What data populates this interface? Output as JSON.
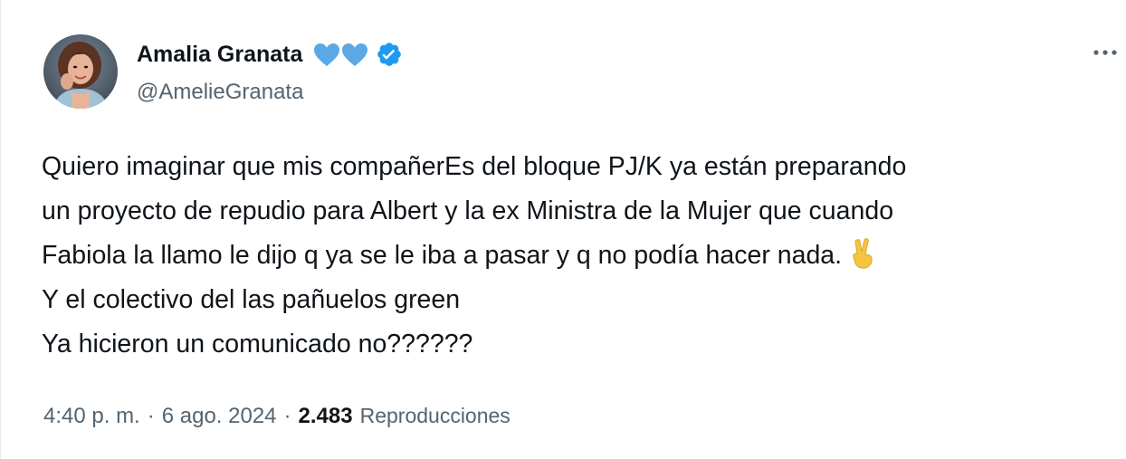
{
  "tweet": {
    "author": {
      "display_name": "Amalia Granata",
      "handle": "@AmelieGranata",
      "avatar": "profile-photo",
      "badges": [
        "light-blue-heart-icon",
        "light-blue-heart-icon",
        "verified-badge-icon"
      ]
    },
    "more_icon": "more-options-icon",
    "text_lines": [
      "Quiero imaginar que mis compañerEs del bloque PJ/K ya están preparando",
      "un proyecto de repudio para Albert y la ex Ministra de la Mujer que cuando",
      "Fabiola la llamo le dijo q ya se le iba a pasar y q no podía hacer nada.",
      "Y el colectivo del las pañuelos green",
      "Ya hicieron un comunicado no??????"
    ],
    "emoji": "victory-hand-icon",
    "meta": {
      "time": "4:40 p. m.",
      "separator": "·",
      "date": "6 ago. 2024",
      "views_count": "2.483",
      "views_label": "Reproducciones"
    }
  },
  "colors": {
    "text_primary": "#0f1419",
    "text_secondary": "#536471",
    "verified_blue": "#1d9bf0",
    "heart_blue": "#5aa9e6",
    "victory_hand": "#f5c542"
  }
}
